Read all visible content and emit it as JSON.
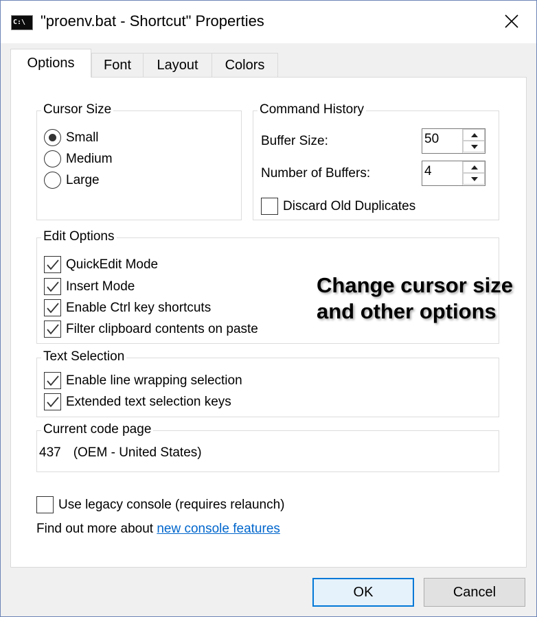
{
  "window": {
    "title": "\"proenv.bat - Shortcut\" Properties",
    "icon": "console-icon",
    "icon_text": "C:\\",
    "close_icon": "close-icon"
  },
  "tabs": [
    {
      "label": "Options",
      "active": true
    },
    {
      "label": "Font",
      "active": false
    },
    {
      "label": "Layout",
      "active": false
    },
    {
      "label": "Colors",
      "active": false
    }
  ],
  "cursor_size": {
    "title": "Cursor Size",
    "options": [
      {
        "label": "Small",
        "selected": true
      },
      {
        "label": "Medium",
        "selected": false
      },
      {
        "label": "Large",
        "selected": false
      }
    ]
  },
  "command_history": {
    "title": "Command History",
    "buffer_size_label": "Buffer Size:",
    "buffer_size_value": "50",
    "num_buffers_label": "Number of Buffers:",
    "num_buffers_value": "4",
    "discard_label": "Discard Old Duplicates",
    "discard_checked": false
  },
  "edit_options": {
    "title": "Edit Options",
    "items": [
      {
        "label": "QuickEdit Mode",
        "checked": true
      },
      {
        "label": "Insert Mode",
        "checked": true
      },
      {
        "label": "Enable Ctrl key shortcuts",
        "checked": true
      },
      {
        "label": "Filter clipboard contents on paste",
        "checked": true
      }
    ]
  },
  "text_selection": {
    "title": "Text Selection",
    "items": [
      {
        "label": "Enable line wrapping selection",
        "checked": true
      },
      {
        "label": "Extended text selection keys",
        "checked": true
      }
    ]
  },
  "code_page": {
    "title": "Current code page",
    "number": "437",
    "name": "(OEM - United States)"
  },
  "legacy": {
    "label": "Use legacy console (requires relaunch)",
    "checked": false
  },
  "find_more": {
    "prefix": "Find out more about ",
    "link": "new console features"
  },
  "annotation": {
    "line1": "Change cursor size",
    "line2": "and other options"
  },
  "buttons": {
    "ok": "OK",
    "cancel": "Cancel"
  },
  "colors": {
    "link": "#0066cc",
    "default_button_border": "#0078d7",
    "window_border": "#6b84b8"
  }
}
